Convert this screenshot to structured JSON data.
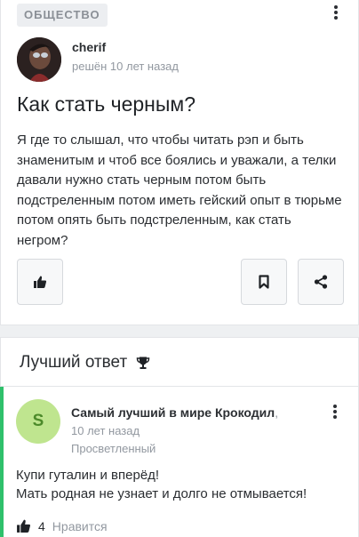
{
  "question": {
    "category": "ОБЩЕСТВО",
    "author": "cherif",
    "meta": "решён 10 лет назад",
    "title": "Как стать черным?",
    "body": "Я где то слышал, что чтобы читать рэп и быть знаменитым и чтоб все боялись и уважали, а телки давали нужно стать черным потом быть подстреленным потом иметь гейский опыт в тюрьме потом опять быть подстреленным, как стать негром?"
  },
  "best_answer": {
    "header": "Лучший ответ",
    "avatar_letter": "S",
    "author": "Самый лучший в мире Крокодил",
    "author_suffix": ",",
    "time": "10 лет назад",
    "rank": "Просветленный",
    "body_line1": "Купи гуталин и вперёд!",
    "body_line2": "Мать родная не узнает и долго не отмывается!",
    "like_count": "4",
    "like_label": "Нравится"
  },
  "icons": {
    "more": "kebab-menu-icon",
    "like": "thumbs-up-icon",
    "bookmark": "bookmark-icon",
    "share": "share-icon",
    "trophy": "trophy-icon"
  },
  "colors": {
    "accent_green": "#2fc06b",
    "avatar_green": "#bfe58f"
  }
}
